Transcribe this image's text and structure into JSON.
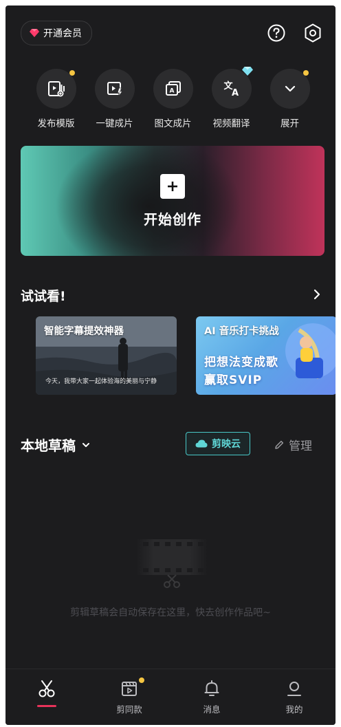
{
  "header": {
    "vip_label": "开通会员",
    "icons": [
      "diamond-icon",
      "help-icon",
      "settings-icon"
    ]
  },
  "tools": [
    {
      "label": "发布模版",
      "icon": "template-publish-icon",
      "dot": true
    },
    {
      "label": "一键成片",
      "icon": "one-click-video-icon",
      "dot": false
    },
    {
      "label": "图文成片",
      "icon": "text-to-video-icon",
      "dot": false
    },
    {
      "label": "视频翻译",
      "icon": "translate-icon",
      "badge": "diamond"
    },
    {
      "label": "展开",
      "icon": "chevron-down-icon",
      "dot": true
    }
  ],
  "hero": {
    "label": "开始创作"
  },
  "try": {
    "title": "试试看!",
    "cards": [
      {
        "title": "智能字幕提效神器",
        "subtitle": "今天，我带大家一起体验海的美丽与宁静"
      },
      {
        "title": "AI 音乐打卡挑战",
        "line1": "把想法变成歌",
        "line2": "赢取SVIP"
      }
    ]
  },
  "drafts": {
    "title": "本地草稿",
    "cloud_label": "剪映云",
    "manage_label": "管理",
    "empty_text": "剪辑草稿会自动保存在这里，快去创作作品吧~"
  },
  "tabbar": [
    {
      "label": "",
      "icon": "scissors-icon",
      "active": true
    },
    {
      "label": "剪同款",
      "icon": "clapperboard-icon",
      "dot": true
    },
    {
      "label": "消息",
      "icon": "bell-icon"
    },
    {
      "label": "我的",
      "icon": "profile-icon"
    }
  ],
  "colors": {
    "background": "#1c1c1e",
    "accent_teal": "#5fd6d6",
    "accent_red": "#e8335a",
    "badge_yellow": "#f5c542"
  }
}
